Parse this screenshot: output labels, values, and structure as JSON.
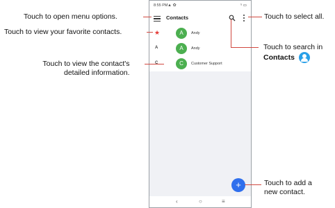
{
  "phone": {
    "status": {
      "time": "8:55",
      "time_suffix": "PM",
      "left_icons": "▲ ✿",
      "right_icons": "⁵ ▭"
    },
    "appbar": {
      "title": "Contacts"
    },
    "contacts": [
      {
        "index": "★",
        "initial": "A",
        "name": "Andy"
      },
      {
        "index": "A",
        "initial": "A",
        "name": "Andy"
      },
      {
        "index": "C",
        "initial": "C",
        "name": "Customer Support"
      }
    ],
    "fab_symbol": "+",
    "navbar": {
      "back": "‹",
      "home": "○",
      "recents": "≡"
    }
  },
  "callouts": {
    "menu": "Touch to open menu options.",
    "favorites": "Touch to view your favorite contacts.",
    "details_line1": "Touch to view the contact's",
    "details_line2": "detailed information.",
    "select_all": "Touch to select all.",
    "search_line1": "Touch to search in",
    "search_line2": "Contacts",
    "add_line1": "Touch to add a",
    "add_line2": "new contact."
  },
  "colors": {
    "accent": "#2f6fed",
    "avatar": "#4caf50",
    "star": "#e53935",
    "callout_line": "#d0473e",
    "contacts_badge": "#29a0e8"
  },
  "icons": [
    "menu-icon",
    "search-icon",
    "more-options-icon",
    "star-icon",
    "add-icon",
    "contacts-app-icon"
  ]
}
